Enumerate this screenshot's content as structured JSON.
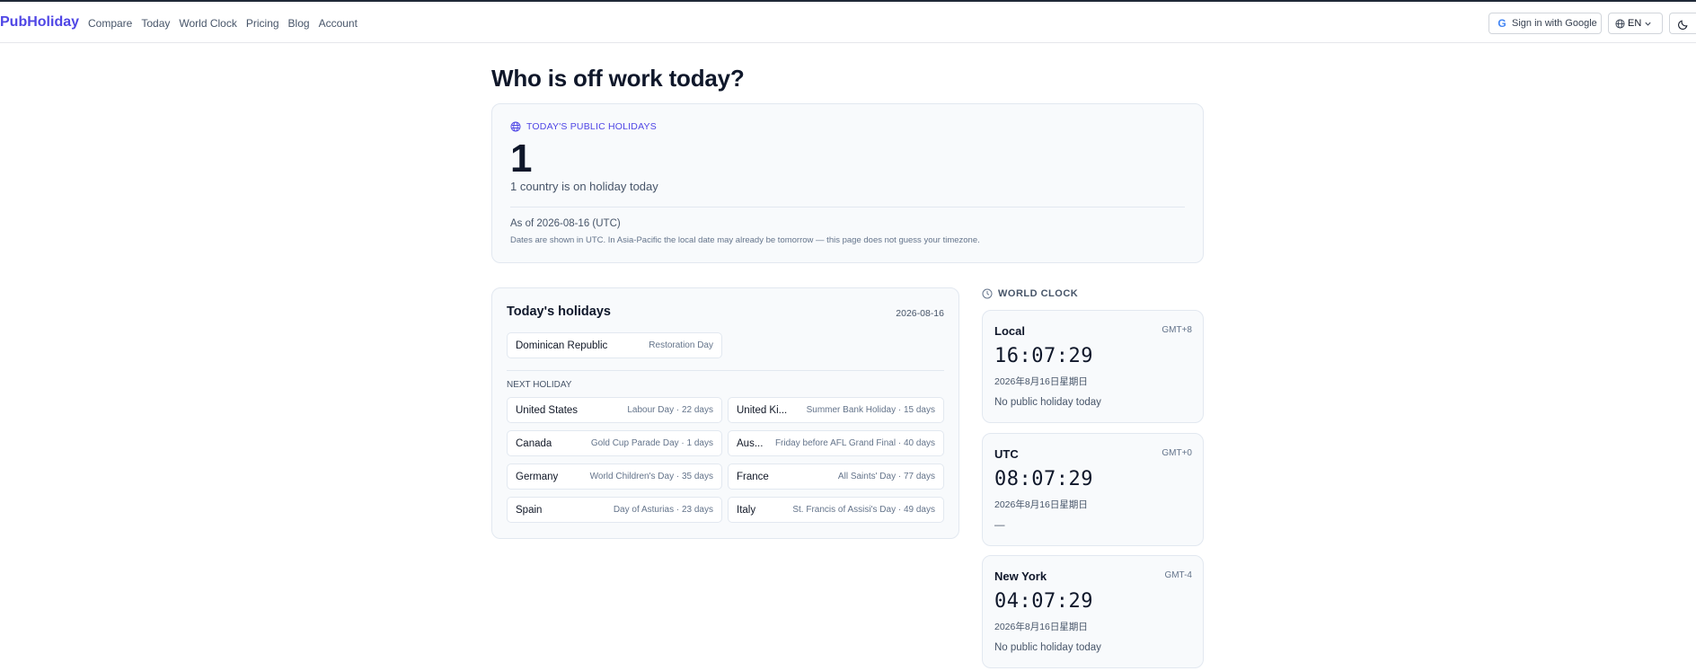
{
  "header": {
    "brand": "PubHoliday",
    "nav": [
      "Compare",
      "Today",
      "World Clock",
      "Pricing",
      "Blog",
      "Account"
    ],
    "signin_label": "Sign in with Google",
    "lang_label": "EN"
  },
  "page": {
    "title": "Who is off work today?"
  },
  "summary": {
    "label": "TODAY'S PUBLIC HOLIDAYS",
    "count": "1",
    "subtitle": "1 country is on holiday today",
    "as_of": "As of 2026-08-16 (UTC)",
    "note": "Dates are shown in UTC. In Asia-Pacific the local date may already be tomorrow — this page does not guess your timezone."
  },
  "holidays": {
    "title": "Today's holidays",
    "date": "2026-08-16",
    "today": [
      {
        "country": "Dominican Republic",
        "name": "Restoration Day"
      }
    ],
    "next_label": "NEXT HOLIDAY",
    "next": [
      {
        "country": "United States",
        "detail": "Labour Day · 22 days"
      },
      {
        "country": "United Ki...",
        "detail": "Summer Bank Holiday · 15 days"
      },
      {
        "country": "Canada",
        "detail": "Gold Cup Parade Day · 1 days"
      },
      {
        "country": "Aus...",
        "detail": "Friday before AFL Grand Final · 40 days"
      },
      {
        "country": "Germany",
        "detail": "World Children's Day · 35 days"
      },
      {
        "country": "France",
        "detail": "All Saints' Day · 77 days"
      },
      {
        "country": "Spain",
        "detail": "Day of Asturias · 23 days"
      },
      {
        "country": "Italy",
        "detail": "St. Francis of Assisi's Day · 49 days"
      }
    ]
  },
  "world_clock": {
    "heading": "WORLD CLOCK",
    "clocks": [
      {
        "name": "Local",
        "offset": "GMT+8",
        "time": "16:07:29",
        "date": "2026年8月16日星期日",
        "status": "No public holiday today"
      },
      {
        "name": "UTC",
        "offset": "GMT+0",
        "time": "08:07:29",
        "date": "2026年8月16日星期日",
        "status": "—"
      },
      {
        "name": "New York",
        "offset": "GMT-4",
        "time": "04:07:29",
        "date": "2026年8月16日星期日",
        "status": "No public holiday today"
      }
    ]
  },
  "colors": {
    "accent": "#4f46e5",
    "card_bg": "#f8fafc",
    "border": "#e2e8f0"
  }
}
